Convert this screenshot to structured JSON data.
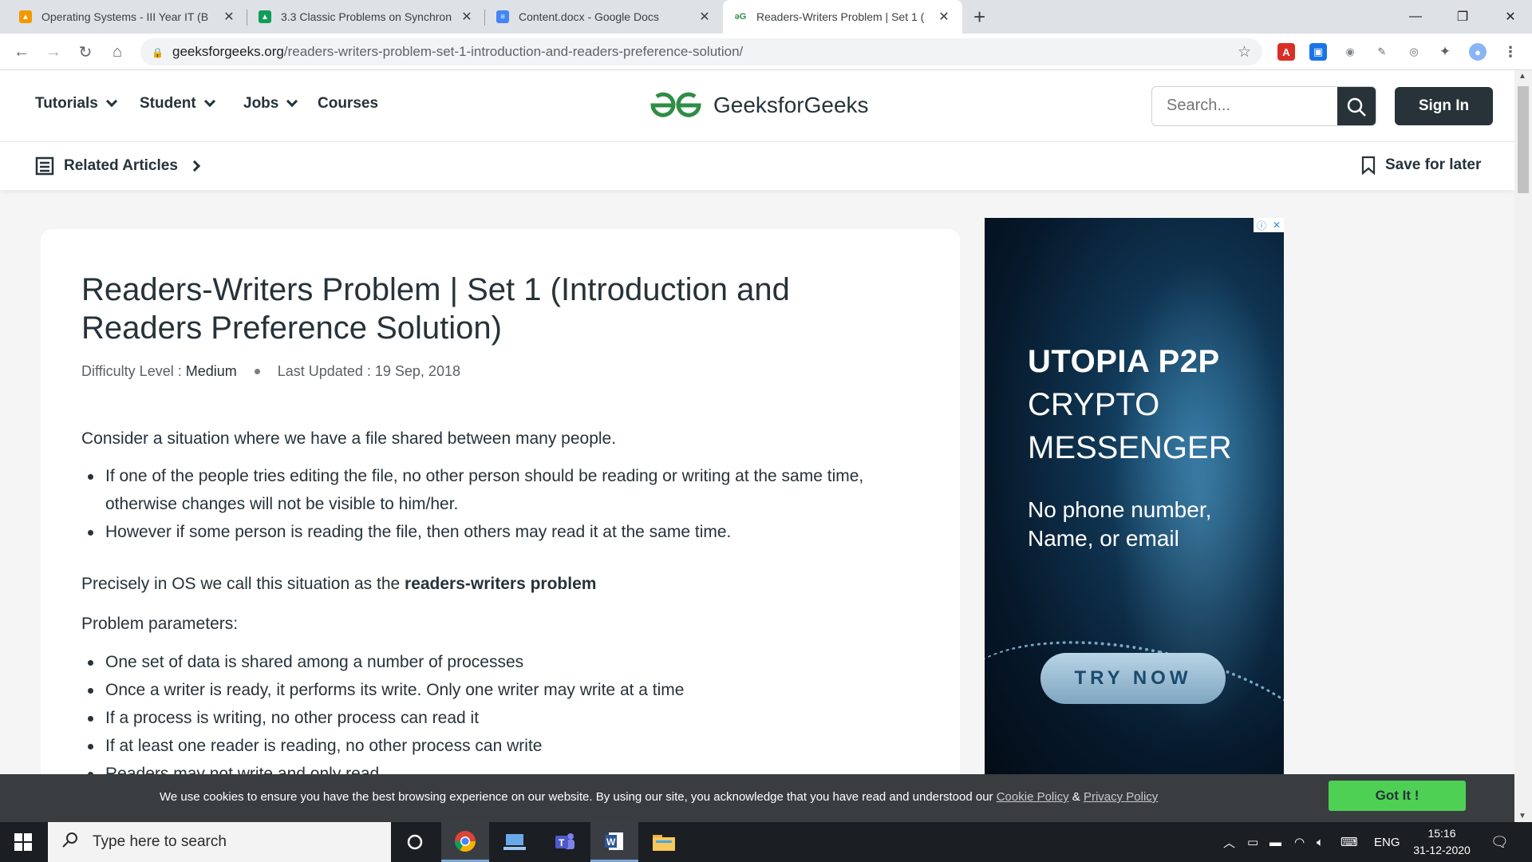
{
  "browser": {
    "tabs": [
      {
        "title": "Operating Systems - III Year IT (B",
        "color": "#f29900",
        "icon": "classroom-icon"
      },
      {
        "title": "3.3 Classic Problems on Synchron",
        "color": "#0f9d58",
        "icon": "drive-icon"
      },
      {
        "title": "Content.docx - Google Docs",
        "color": "#4285f4",
        "icon": "docs-icon"
      },
      {
        "title": "Readers-Writers Problem | Set 1 (",
        "color": "#2f8d46",
        "icon": "gfg-icon"
      }
    ],
    "url_domain": "geeksforgeeks.org",
    "url_path": "/readers-writers-problem-set-1-introduction-and-readers-preference-solution/"
  },
  "header": {
    "nav": [
      {
        "label": "Tutorials",
        "has_dropdown": true
      },
      {
        "label": "Student",
        "has_dropdown": true
      },
      {
        "label": "Jobs",
        "has_dropdown": true
      },
      {
        "label": "Courses",
        "has_dropdown": false
      }
    ],
    "logo_text": "GeeksforGeeks",
    "search_placeholder": "Search...",
    "signin_label": "Sign In",
    "related_label": "Related Articles",
    "save_label": "Save for later"
  },
  "article": {
    "title": "Readers-Writers Problem | Set 1 (Introduction and Readers Preference Solution)",
    "difficulty_label": "Difficulty Level :",
    "difficulty_value": "Medium",
    "updated_label": "Last Updated :",
    "updated_value": "19 Sep, 2018",
    "intro": "Consider a situation where we have a file shared between many people.",
    "intro_bullets": [
      "If one of the people tries editing the file, no other person should be reading or writing at the same time, otherwise changes will not be visible to him/her.",
      "However if some person is reading the file, then others may read it at the same time."
    ],
    "precisely_prefix": "Precisely in OS we call this situation as the ",
    "precisely_bold": "readers-writers problem",
    "params_heading": "Problem parameters:",
    "param_bullets": [
      "One set of data is shared among a number of processes",
      "Once a writer is ready, it performs its write. Only one writer may write at a time",
      "If a process is writing, no other process can read it",
      "If at least one reader is reading, no other process can write",
      "Readers may not write and only read"
    ]
  },
  "ad": {
    "line1": "UTOPIA P2P",
    "line2": "CRYPTO",
    "line3": "MESSENGER",
    "sub": "No phone number, Name, or email",
    "cta": "TRY NOW"
  },
  "cookie": {
    "message": "We use cookies to ensure you have the best browsing experience on our website. By using our site, you acknowledge that you have read and understood our ",
    "cookie_policy": "Cookie Policy",
    "amp": " & ",
    "privacy_policy": "Privacy Policy",
    "button": "Got It !"
  },
  "taskbar": {
    "search_placeholder": "Type here to search",
    "lang": "ENG",
    "time": "15:16",
    "date": "31-12-2020"
  }
}
